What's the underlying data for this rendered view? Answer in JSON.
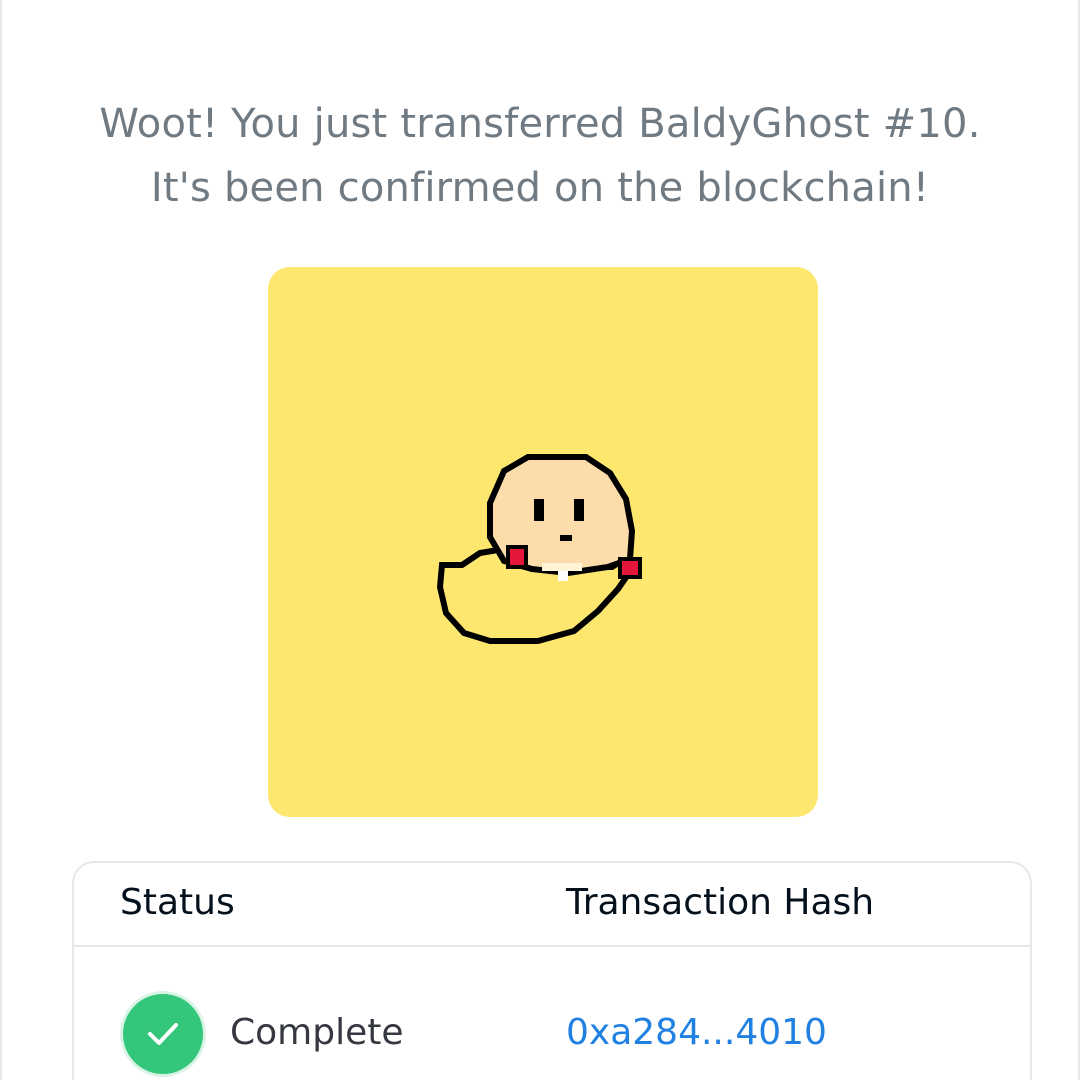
{
  "message": {
    "line1": "Woot! You just transferred BaldyGhost #10.",
    "line2": "It's been confirmed on the blockchain!"
  },
  "nft": {
    "name": "BaldyGhost #10",
    "background_color": "#fde76e"
  },
  "transaction": {
    "status_header": "Status",
    "hash_header": "Transaction Hash",
    "status": "Complete",
    "hash": "0xa284...4010",
    "status_icon": "check-icon"
  },
  "colors": {
    "headline": "#707a83",
    "success": "#34c77b",
    "link": "#2081e2",
    "border": "#e5e8eb"
  }
}
